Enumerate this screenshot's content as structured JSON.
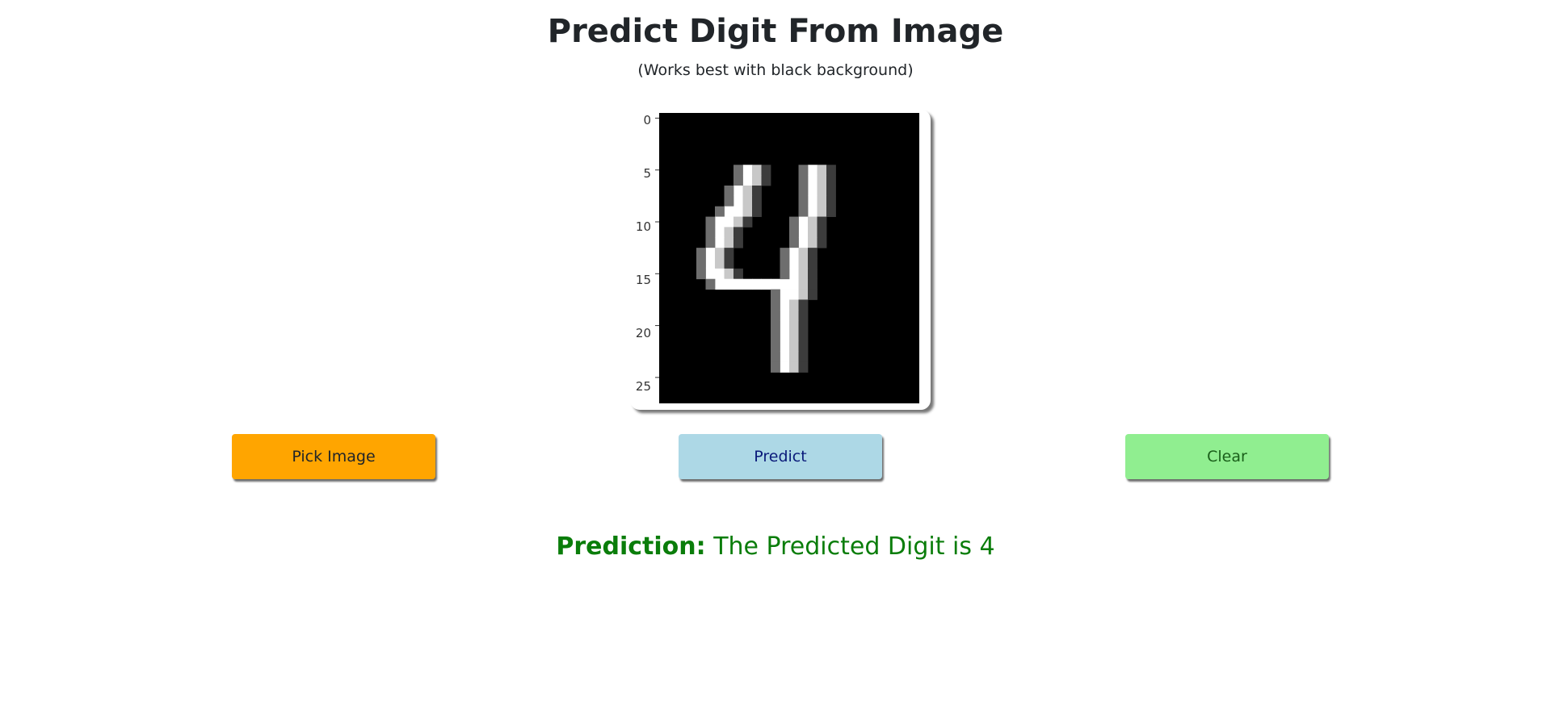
{
  "header": {
    "title": "Predict Digit From Image",
    "subtitle": "(Works best with black background)"
  },
  "image_preview": {
    "y_tick_labels": [
      "0",
      "5",
      "10",
      "15",
      "20",
      "25"
    ],
    "content": "handwritten digit 4, white on black, 28x28 pixels"
  },
  "buttons": {
    "pick_label": "Pick Image",
    "predict_label": "Predict",
    "clear_label": "Clear"
  },
  "result": {
    "label": "Prediction:",
    "text": "The Predicted Digit is 4"
  },
  "colors": {
    "pick_button": "#ffa500",
    "predict_button": "#add8e6",
    "clear_button": "#90ee90",
    "prediction_text": "#0a7d0a"
  }
}
